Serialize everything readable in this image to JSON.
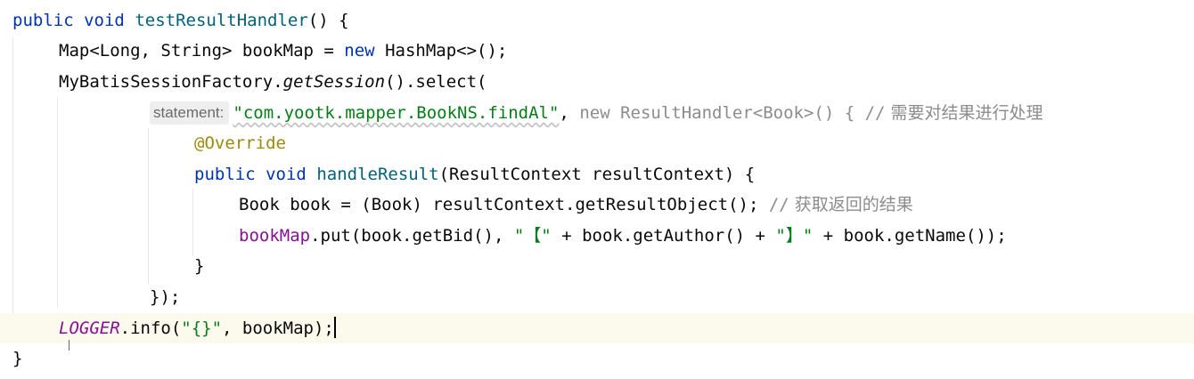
{
  "editor": {
    "colors": {
      "keyword": "#0033b3",
      "method": "#00627a",
      "string": "#067d17",
      "comment": "#8c8c8c",
      "annotation": "#9e880d",
      "field": "#871094",
      "current_line": "#fcfaed"
    },
    "lines": [
      {
        "kw1": "public",
        "kw2": "void",
        "name": "testResultHandler",
        "rest": "() {"
      },
      {
        "type": "Map<Long, String> bookMap = ",
        "kw": "new",
        "rest": " HashMap<>();"
      },
      {
        "obj": "MyBatisSessionFactory.",
        "method": "getSession",
        "rest": "().select("
      },
      {
        "hint": "statement:",
        "str": "\"com.yootk.mapper.BookNS.findAl\"",
        "sep": ", ",
        "code": "new ResultHandler<Book>() { //",
        "comment": " 需要对结果进行处理"
      },
      {
        "anno": "@Override"
      },
      {
        "kw1": "public",
        "kw2": "void",
        "name": "handleResult",
        "rest": "(ResultContext resultContext) {"
      },
      {
        "code": "Book book = (Book) resultContext.getResultObject(); ",
        "comment_mark": "//",
        "comment": " 获取返回的结果"
      },
      {
        "field": "bookMap",
        "part1": ".put(book.getBid(), ",
        "str1": "\"【\"",
        "part2": " + book.getAuthor() + ",
        "str2": "\"】\"",
        "part3": " + book.getName());"
      },
      {
        "code": "}"
      },
      {
        "code": "});"
      },
      {
        "field": "LOGGER",
        "part1": ".info(",
        "str": "\"{}\"",
        "part2": ", bookMap);"
      },
      {
        "code": "}"
      }
    ]
  }
}
